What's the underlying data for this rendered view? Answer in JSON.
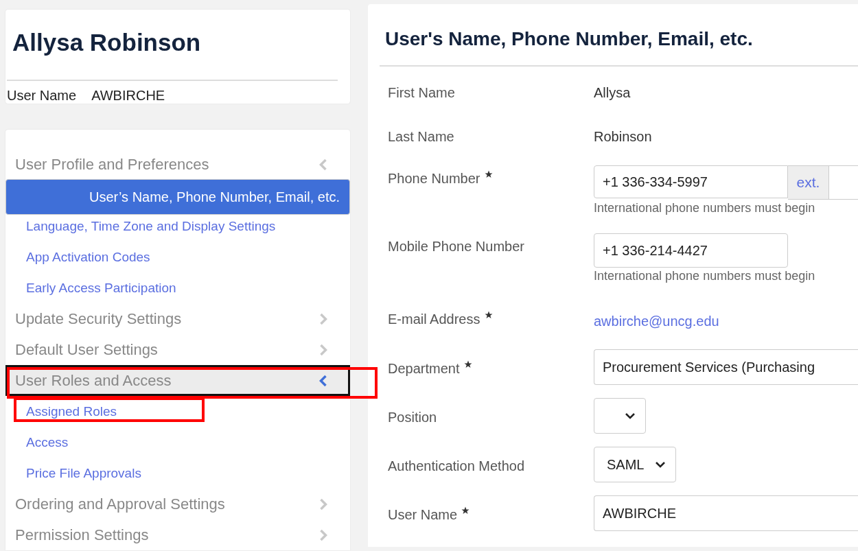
{
  "profile": {
    "name": "Allysa Robinson",
    "user_name_label": "User Name",
    "user_name": "AWBIRCHE"
  },
  "nav": [
    {
      "label": "User Profile and Preferences",
      "expanded": true,
      "focused": false,
      "highlighted": false,
      "children": [
        {
          "label": "User’s Name, Phone Number, Email, etc.",
          "selected": true,
          "highlighted": false
        },
        {
          "label": "Language, Time Zone and Display Settings",
          "selected": false,
          "highlighted": false
        },
        {
          "label": "App Activation Codes",
          "selected": false,
          "highlighted": false
        },
        {
          "label": "Early Access Participation",
          "selected": false,
          "highlighted": false
        }
      ]
    },
    {
      "label": "Update Security Settings",
      "expanded": false,
      "focused": false,
      "highlighted": false
    },
    {
      "label": "Default User Settings",
      "expanded": false,
      "focused": false,
      "highlighted": false
    },
    {
      "label": "User Roles and Access",
      "expanded": true,
      "focused": true,
      "highlighted": true,
      "children": [
        {
          "label": "Assigned Roles",
          "selected": false,
          "highlighted": true
        },
        {
          "label": "Access",
          "selected": false,
          "highlighted": false
        },
        {
          "label": "Price File Approvals",
          "selected": false,
          "highlighted": false
        }
      ]
    },
    {
      "label": "Ordering and Approval Settings",
      "expanded": false,
      "focused": false,
      "highlighted": false
    },
    {
      "label": "Permission Settings",
      "expanded": false,
      "focused": false,
      "highlighted": false
    }
  ],
  "form": {
    "title": "User's Name, Phone Number, Email, etc.",
    "fields": [
      {
        "kind": "text",
        "label": "First Name",
        "required": false,
        "value": "Allysa"
      },
      {
        "kind": "text",
        "label": "Last Name",
        "required": false,
        "value": "Robinson"
      },
      {
        "kind": "phone",
        "label": "Phone Number",
        "required": true,
        "value": "+1 336-334-5997",
        "ext": "ext.",
        "hint": "International phone numbers must begin"
      },
      {
        "kind": "input",
        "label": "Mobile Phone Number",
        "required": false,
        "value": "+1 336-214-4427",
        "hint": "International phone numbers must begin"
      },
      {
        "kind": "link",
        "label": "E-mail Address",
        "required": true,
        "value": "awbirche@uncg.edu"
      },
      {
        "kind": "wide",
        "label": "Department",
        "required": true,
        "value": "Procurement Services (Purchasing"
      },
      {
        "kind": "select",
        "label": "Position",
        "required": false
      },
      {
        "kind": "select",
        "label": "Authentication Method",
        "required": false,
        "value": "SAML"
      },
      {
        "kind": "wide",
        "label": "User Name",
        "required": true,
        "value": "AWBIRCHE"
      }
    ]
  }
}
